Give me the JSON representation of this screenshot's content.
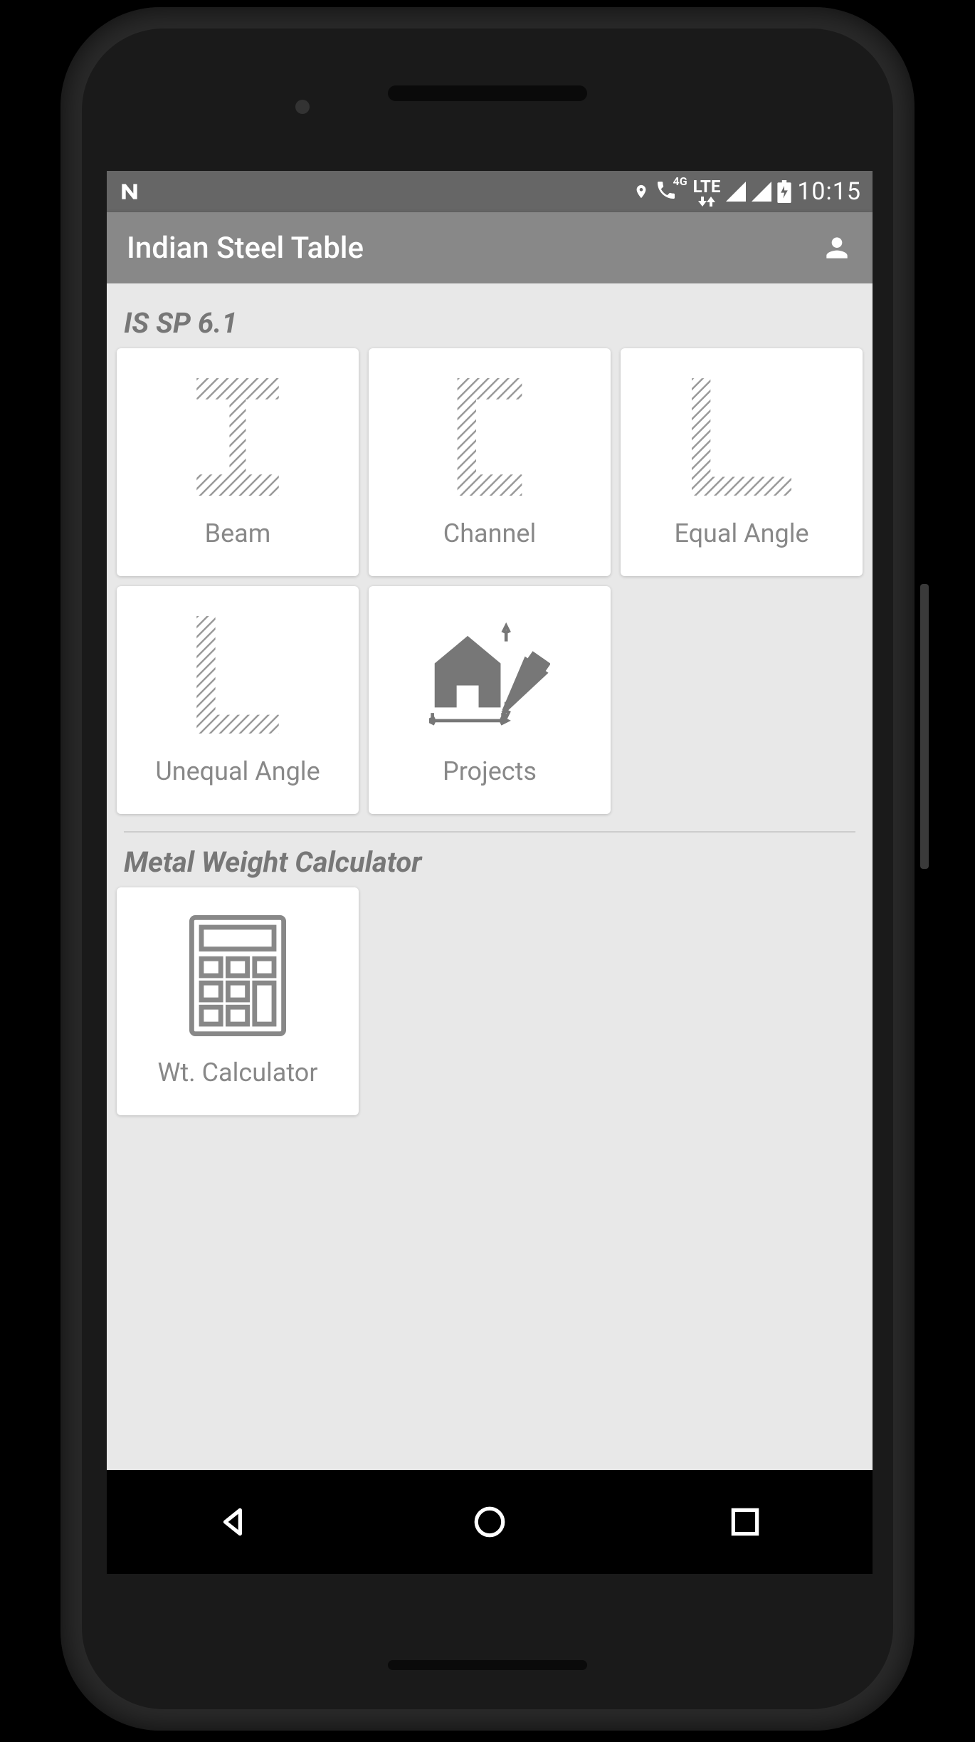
{
  "statusBar": {
    "lte": "LTE",
    "fourG": "4G",
    "time": "10:15"
  },
  "appBar": {
    "title": "Indian Steel Table"
  },
  "sections": {
    "sp61": {
      "title": "IS SP 6.1",
      "items": {
        "beam": "Beam",
        "channel": "Channel",
        "equalAngle": "Equal Angle",
        "unequalAngle": "Unequal Angle",
        "projects": "Projects"
      }
    },
    "calc": {
      "title": "Metal Weight Calculator",
      "items": {
        "wtCalc": "Wt. Calculator"
      }
    }
  }
}
